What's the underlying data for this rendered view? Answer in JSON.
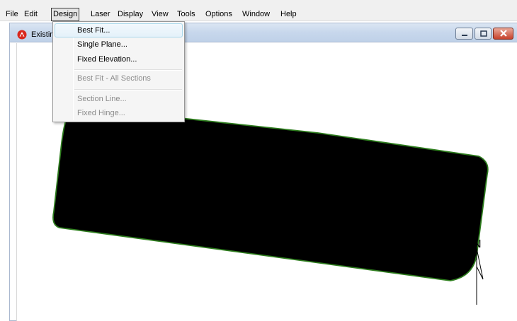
{
  "menubar": {
    "items": [
      "File",
      "Edit",
      "Design",
      "Laser",
      "Display",
      "View",
      "Tools",
      "Options",
      "Window",
      "Help"
    ]
  },
  "child_window": {
    "title": "Existin"
  },
  "design_menu": {
    "items": [
      {
        "label": "Best Fit...",
        "enabled": true
      },
      {
        "label": "Single Plane...",
        "enabled": true
      },
      {
        "label": "Fixed Elevation...",
        "enabled": true
      },
      {
        "label": "Best Fit - All Sections",
        "enabled": false
      },
      {
        "label": "Section Line...",
        "enabled": false
      },
      {
        "label": "Fixed Hinge...",
        "enabled": false
      }
    ]
  },
  "map": {
    "north_label": "N",
    "field_fill": "#000000",
    "field_outline": "#2e7d1e"
  }
}
